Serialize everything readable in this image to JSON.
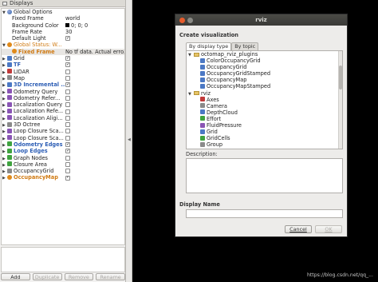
{
  "displays_panel": {
    "title": "Displays",
    "rows": [
      {
        "name": "Global Options",
        "value": "",
        "indent": 0,
        "arrow": "▼",
        "icon": "globe",
        "style": ""
      },
      {
        "name": "Fixed Frame",
        "value": "world",
        "indent": 1,
        "arrow": "",
        "icon": "",
        "style": ""
      },
      {
        "name": "Background Color",
        "value": "0; 0; 0",
        "indent": 1,
        "arrow": "",
        "icon": "",
        "style": "",
        "swatch": true
      },
      {
        "name": "Frame Rate",
        "value": "30",
        "indent": 1,
        "arrow": "",
        "icon": "",
        "style": ""
      },
      {
        "name": "Default Light",
        "value": "",
        "indent": 1,
        "arrow": "",
        "icon": "",
        "style": "",
        "check": "on"
      },
      {
        "name": "Global Status: W...",
        "value": "",
        "indent": 0,
        "arrow": "▼",
        "icon": "warn",
        "style": "t-orange"
      },
      {
        "name": "Fixed Frame",
        "value": "No tf data.  Actual erro...",
        "indent": 1,
        "arrow": "",
        "icon": "warn",
        "style": "t-orange-b",
        "selected": true
      },
      {
        "name": "Grid",
        "value": "",
        "indent": 0,
        "arrow": "▶",
        "icon": "blue",
        "style": "",
        "check": "on"
      },
      {
        "name": "TF",
        "value": "",
        "indent": 0,
        "arrow": "▶",
        "icon": "blue",
        "style": "t-blue-b",
        "check": "on"
      },
      {
        "name": "LIDAR",
        "value": "",
        "indent": 0,
        "arrow": "▶",
        "icon": "red",
        "style": "",
        "check": "off"
      },
      {
        "name": "Map",
        "value": "",
        "indent": 0,
        "arrow": "▶",
        "icon": "grey",
        "style": "",
        "check": "off"
      },
      {
        "name": "3D Incremental ...",
        "value": "",
        "indent": 0,
        "arrow": "▶",
        "icon": "blue",
        "style": "t-blue-b",
        "check": "on"
      },
      {
        "name": "Odometry Query",
        "value": "",
        "indent": 0,
        "arrow": "▶",
        "icon": "purple",
        "style": "",
        "check": "off"
      },
      {
        "name": "Odometry Refer...",
        "value": "",
        "indent": 0,
        "arrow": "▶",
        "icon": "purple",
        "style": "",
        "check": "off"
      },
      {
        "name": "Localization Query",
        "value": "",
        "indent": 0,
        "arrow": "▶",
        "icon": "purple",
        "style": "",
        "check": "off"
      },
      {
        "name": "Localization Refe...",
        "value": "",
        "indent": 0,
        "arrow": "▶",
        "icon": "purple",
        "style": "",
        "check": "off"
      },
      {
        "name": "Localization Aligi...",
        "value": "",
        "indent": 0,
        "arrow": "▶",
        "icon": "purple",
        "style": "",
        "check": "off"
      },
      {
        "name": "3D Octree",
        "value": "",
        "indent": 0,
        "arrow": "▶",
        "icon": "grey",
        "style": "",
        "check": "off"
      },
      {
        "name": "Loop Closure Sca...",
        "value": "",
        "indent": 0,
        "arrow": "▶",
        "icon": "purple",
        "style": "",
        "check": "off"
      },
      {
        "name": "Loop Closure Sca...",
        "value": "",
        "indent": 0,
        "arrow": "▶",
        "icon": "purple",
        "style": "",
        "check": "off"
      },
      {
        "name": "Odometry Edges",
        "value": "",
        "indent": 0,
        "arrow": "▶",
        "icon": "green",
        "style": "t-blue-b",
        "check": "on"
      },
      {
        "name": "Loop Edges",
        "value": "",
        "indent": 0,
        "arrow": "▶",
        "icon": "green",
        "style": "t-blue-b",
        "check": "on"
      },
      {
        "name": "Graph Nodes",
        "value": "",
        "indent": 0,
        "arrow": "▶",
        "icon": "green",
        "style": "",
        "check": "off"
      },
      {
        "name": "Closure Area",
        "value": "",
        "indent": 0,
        "arrow": "▶",
        "icon": "green",
        "style": "",
        "check": "off"
      },
      {
        "name": "OccupancyGrid",
        "value": "",
        "indent": 0,
        "arrow": "▶",
        "icon": "grey",
        "style": "",
        "check": "off"
      },
      {
        "name": "OccupancyMap",
        "value": "",
        "indent": 0,
        "arrow": "▶",
        "icon": "warn",
        "style": "t-orange-b",
        "check": "on"
      }
    ],
    "buttons": {
      "add": "Add",
      "duplicate": "Duplicate",
      "remove": "Remove",
      "rename": "Rename"
    }
  },
  "dialog": {
    "title": "rviz",
    "create_label": "Create visualization",
    "tabs": [
      "By display type",
      "By topic"
    ],
    "list": [
      {
        "text": "octomap_rviz_plugins",
        "level": 1,
        "folder": true,
        "tri": "▼"
      },
      {
        "text": "ColorOccupancyGrid",
        "level": 2,
        "icon": "blue"
      },
      {
        "text": "OccupancyGrid",
        "level": 2,
        "icon": "blue"
      },
      {
        "text": "OccupancyGridStamped",
        "level": 2,
        "icon": "blue"
      },
      {
        "text": "OccupancyMap",
        "level": 2,
        "icon": "blue"
      },
      {
        "text": "OccupancyMapStamped",
        "level": 2,
        "icon": "blue"
      },
      {
        "text": "rviz",
        "level": 1,
        "folder": true,
        "tri": "▼"
      },
      {
        "text": "Axes",
        "level": 2,
        "icon": "red"
      },
      {
        "text": "Camera",
        "level": 2,
        "icon": "grey"
      },
      {
        "text": "DepthCloud",
        "level": 2,
        "icon": "blue"
      },
      {
        "text": "Effort",
        "level": 2,
        "icon": "green"
      },
      {
        "text": "FluidPressure",
        "level": 2,
        "icon": "purple"
      },
      {
        "text": "Grid",
        "level": 2,
        "icon": "blue"
      },
      {
        "text": "GridCells",
        "level": 2,
        "icon": "green"
      },
      {
        "text": "Group",
        "level": 2,
        "icon": "grey"
      }
    ],
    "description_label": "Description:",
    "display_name_label": "Display Name",
    "display_name_value": "",
    "cancel_label": "Cancel",
    "ok_label": "OK"
  },
  "watermark": "https://blog.csdn.net/qq_..."
}
